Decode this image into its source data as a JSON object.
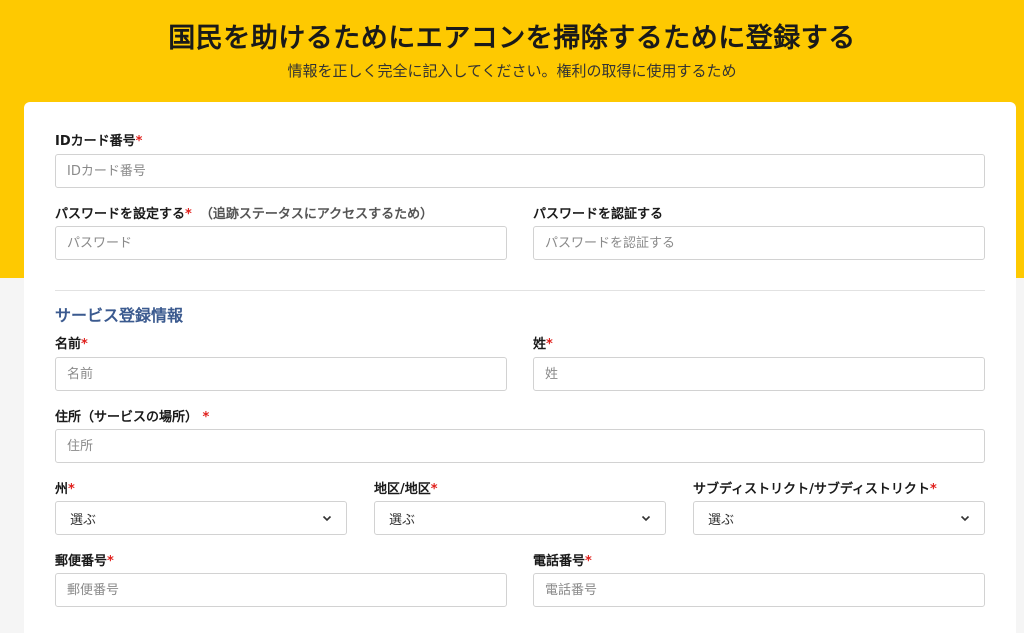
{
  "header": {
    "title": "国民を助けるためにエアコンを掃除するために登録する",
    "subtitle": "情報を正しく完全に記入してください。権利の取得に使用するため"
  },
  "required_mark": "*",
  "fields": {
    "id_card": {
      "label": "IDカード番号",
      "placeholder": "IDカード番号"
    },
    "password": {
      "label": "パスワードを設定する",
      "note": "（追跡ステータスにアクセスするため）",
      "placeholder": "パスワード"
    },
    "confirm_password": {
      "label": "パスワードを認証する",
      "placeholder": "パスワードを認証する"
    },
    "first_name": {
      "label": "名前",
      "placeholder": "名前"
    },
    "last_name": {
      "label": "姓",
      "placeholder": "姓"
    },
    "address": {
      "label": "住所（サービスの場所）",
      "placeholder": "住所"
    },
    "state": {
      "label": "州",
      "selected": "選ぶ"
    },
    "district": {
      "label": "地区/地区",
      "selected": "選ぶ"
    },
    "subdistrict": {
      "label": "サブディストリクト/サブディストリクト",
      "selected": "選ぶ"
    },
    "postal_code": {
      "label": "郵便番号",
      "placeholder": "郵便番号"
    },
    "phone": {
      "label": "電話番号",
      "placeholder": "電話番号"
    }
  },
  "section": {
    "service_title": "サービス登録情報"
  },
  "colors": {
    "banner": "#fec901",
    "required": "#e0201c",
    "section_title": "#3b5a8f"
  }
}
